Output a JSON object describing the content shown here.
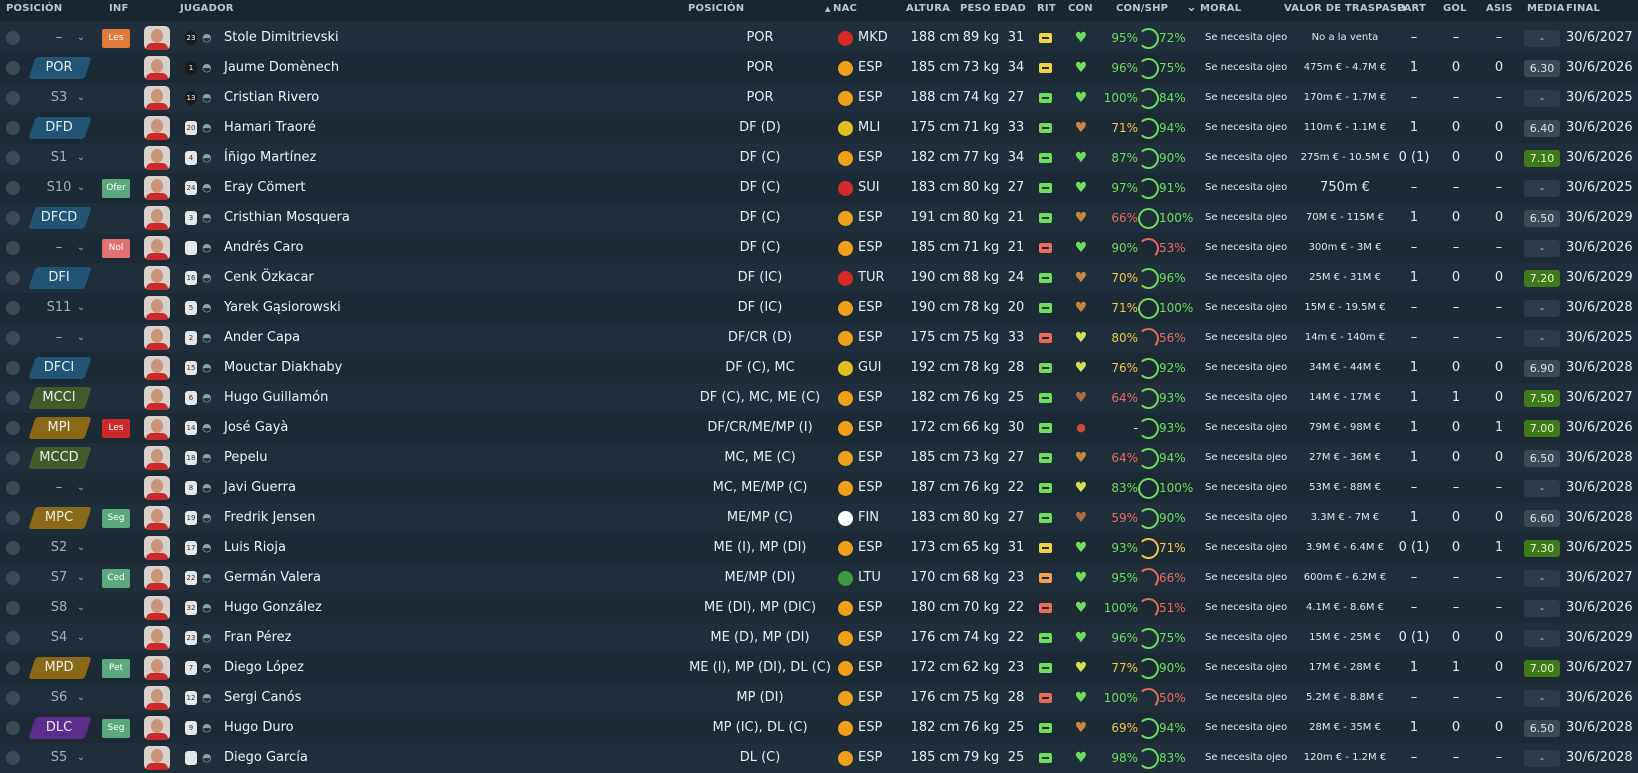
{
  "header": {
    "posicion": "POSICIÓN",
    "inf": "INF",
    "jugador": "JUGADOR",
    "posicion2": "POSICIÓN",
    "nac": "NAC",
    "altura": "ALTURA",
    "peso": "PESO",
    "edad": "EDAD",
    "rit": "RIT",
    "con": "CON",
    "conshp": "CON/SHP",
    "moral": "MORAL",
    "valor": "VALOR DE TRASPASO",
    "part": "PART",
    "gol": "GOL",
    "asis": "ASIS",
    "media": "MEDIA",
    "final": "FINAL",
    "sort_icon": "▲",
    "filter_icon": "⌄"
  },
  "colors": {
    "pos_colors": {
      "POR": "#225476",
      "DFD": "#225476",
      "DFCD": "#225476",
      "DFI": "#225476",
      "DFCI": "#225476",
      "MCCI": "#3e5d2a",
      "MCCD": "#3e5d2a",
      "MPI": "#8a6a16",
      "MPC": "#8a6a16",
      "MPD": "#8a6a16",
      "DLC": "#5c2c8c"
    },
    "inf_colors": {
      "Les": "#cc2a2a",
      "Les2": "#e07b3a",
      "Ofer": "#5aa87b",
      "Nol": "#e07272",
      "Seg": "#5aa87b",
      "Ced": "#5aa87b",
      "Pet": "#5aa87b"
    },
    "rit_colors": {
      "yellow": "#f3d444",
      "green": "#6fdc5c",
      "salmon": "#ec6a5c",
      "orange": "#f0a050"
    },
    "con_colors": {
      "green": "#6fdc5c",
      "brown": "#c9843e",
      "yellow": "#d7de55",
      "redbrown": "#a86b43",
      "red": "#d04a3a"
    },
    "shp_colors": {
      "green": "#6fdc5c",
      "salmon": "#ec6a5c",
      "yellow": "#f0c84a"
    }
  },
  "rows": [
    {
      "pos": "–",
      "posc": "",
      "inf": "Les",
      "infc": "Les2",
      "name": "Stole Dimitrievski",
      "num": "23",
      "numDark": true,
      "rpos": "POR",
      "flag": "#d52a2a",
      "nat": "MKD",
      "alt": "188 cm",
      "peso": "89 kg",
      "edad": "31",
      "rit": "yellow",
      "con": "green",
      "conp": "95%",
      "ring": "green",
      "shp": "72%",
      "shpc": "green",
      "moral": "Se necesita ojeo",
      "val": "No a la venta",
      "valBig": false,
      "part": "–",
      "gol": "–",
      "asis": "–",
      "media": "-",
      "mediaType": "dash",
      "final": "30/6/2027"
    },
    {
      "pos": "POR",
      "posc": "POR",
      "inf": "",
      "infc": "",
      "name": "Jaume Domènech",
      "num": "1",
      "numDark": true,
      "rpos": "POR",
      "flag": "#f0a018",
      "nat": "ESP",
      "alt": "185 cm",
      "peso": "73 kg",
      "edad": "34",
      "rit": "yellow",
      "con": "green",
      "conp": "96%",
      "ring": "green",
      "shp": "75%",
      "shpc": "green",
      "moral": "Se necesita ojeo",
      "val": "475m € - 4.7M €",
      "valBig": false,
      "part": "1",
      "gol": "0",
      "asis": "0",
      "media": "6.30",
      "mediaType": "mid",
      "final": "30/6/2026"
    },
    {
      "pos": "S3",
      "posc": "",
      "inf": "",
      "infc": "",
      "name": "Cristian Rivero",
      "num": "13",
      "numDark": true,
      "rpos": "POR",
      "flag": "#f0a018",
      "nat": "ESP",
      "alt": "188 cm",
      "peso": "74 kg",
      "edad": "27",
      "rit": "green",
      "con": "green",
      "conp": "100%",
      "ring": "green",
      "shp": "84%",
      "shpc": "green",
      "moral": "Se necesita ojeo",
      "val": "170m € - 1.7M €",
      "valBig": false,
      "part": "–",
      "gol": "–",
      "asis": "–",
      "media": "-",
      "mediaType": "dash",
      "final": "30/6/2025"
    },
    {
      "pos": "DFD",
      "posc": "DFD",
      "inf": "",
      "infc": "",
      "name": "Hamari Traoré",
      "num": "20",
      "numDark": false,
      "rpos": "DF (D)",
      "flag": "#e0c020",
      "nat": "MLI",
      "alt": "175 cm",
      "peso": "71 kg",
      "edad": "33",
      "rit": "green",
      "con": "brown",
      "conp": "71%",
      "conpc": "yellow",
      "ring": "green",
      "shp": "94%",
      "shpc": "green",
      "moral": "Se necesita ojeo",
      "val": "110m € - 1.1M €",
      "valBig": false,
      "part": "1",
      "gol": "0",
      "asis": "0",
      "media": "6.40",
      "mediaType": "mid",
      "final": "30/6/2026"
    },
    {
      "pos": "S1",
      "posc": "",
      "inf": "",
      "infc": "",
      "name": "Íñigo Martínez",
      "num": "4",
      "numDark": false,
      "rpos": "DF (C)",
      "flag": "#f0a018",
      "nat": "ESP",
      "alt": "182 cm",
      "peso": "77 kg",
      "edad": "34",
      "rit": "green",
      "con": "green",
      "conp": "87%",
      "ring": "green",
      "shp": "90%",
      "shpc": "green",
      "moral": "Se necesita ojeo",
      "val": "275m € - 10.5M €",
      "valBig": false,
      "part": "0 (1)",
      "gol": "0",
      "asis": "0",
      "media": "7.10",
      "mediaType": "good",
      "final": "30/6/2026"
    },
    {
      "pos": "S10",
      "posc": "",
      "inf": "Ofer",
      "infc": "Ofer",
      "name": "Eray Cömert",
      "num": "24",
      "numDark": false,
      "rpos": "DF (C)",
      "flag": "#d52a2a",
      "nat": "SUI",
      "alt": "183 cm",
      "peso": "80 kg",
      "edad": "27",
      "rit": "green",
      "con": "green",
      "conp": "97%",
      "ring": "green",
      "shp": "91%",
      "shpc": "green",
      "moral": "Se necesita ojeo",
      "val": "750m €",
      "valBig": true,
      "part": "–",
      "gol": "–",
      "asis": "–",
      "media": "-",
      "mediaType": "dash",
      "final": "30/6/2025"
    },
    {
      "pos": "DFCD",
      "posc": "DFCD",
      "inf": "",
      "infc": "",
      "name": "Cristhian Mosquera",
      "num": "3",
      "numDark": false,
      "rpos": "DF (C)",
      "flag": "#f0a018",
      "nat": "ESP",
      "alt": "191 cm",
      "peso": "80 kg",
      "edad": "21",
      "rit": "green",
      "con": "brown",
      "conp": "66%",
      "conpc": "salmon",
      "ring": "green",
      "shp": "100%",
      "shpc": "green",
      "moral": "Se necesita ojeo",
      "val": "70M € - 115M €",
      "valBig": false,
      "part": "1",
      "gol": "0",
      "asis": "0",
      "media": "6.50",
      "mediaType": "mid",
      "final": "30/6/2029"
    },
    {
      "pos": "–",
      "posc": "",
      "inf": "Nol",
      "infc": "Nol",
      "name": "Andrés Caro",
      "num": "",
      "numDark": false,
      "rpos": "DF (C)",
      "flag": "#f0a018",
      "nat": "ESP",
      "alt": "185 cm",
      "peso": "71 kg",
      "edad": "21",
      "rit": "salmon",
      "con": "green",
      "conp": "90%",
      "ring": "salmon",
      "shp": "53%",
      "shpc": "salmon",
      "moral": "Se necesita ojeo",
      "val": "300m € - 3M €",
      "valBig": false,
      "part": "–",
      "gol": "–",
      "asis": "–",
      "media": "-",
      "mediaType": "dash",
      "final": "30/6/2026"
    },
    {
      "pos": "DFI",
      "posc": "DFI",
      "inf": "",
      "infc": "",
      "name": "Cenk Özkacar",
      "num": "16",
      "numDark": false,
      "rpos": "DF (IC)",
      "flag": "#d52a2a",
      "nat": "TUR",
      "alt": "190 cm",
      "peso": "88 kg",
      "edad": "24",
      "rit": "green",
      "con": "brown",
      "conp": "70%",
      "conpc": "yellow",
      "ring": "green",
      "shp": "96%",
      "shpc": "green",
      "moral": "Se necesita ojeo",
      "val": "25M € - 31M €",
      "valBig": false,
      "part": "1",
      "gol": "0",
      "asis": "0",
      "media": "7.20",
      "mediaType": "good",
      "final": "30/6/2029"
    },
    {
      "pos": "S11",
      "posc": "",
      "inf": "",
      "infc": "",
      "name": "Yarek Gąsiorowski",
      "num": "5",
      "numDark": false,
      "rpos": "DF (IC)",
      "flag": "#f0a018",
      "nat": "ESP",
      "alt": "190 cm",
      "peso": "78 kg",
      "edad": "20",
      "rit": "green",
      "con": "brown",
      "conp": "71%",
      "conpc": "yellow",
      "ring": "green",
      "shp": "100%",
      "shpc": "green",
      "moral": "Se necesita ojeo",
      "val": "15M € - 19.5M €",
      "valBig": false,
      "part": "–",
      "gol": "–",
      "asis": "–",
      "media": "-",
      "mediaType": "dash",
      "final": "30/6/2028"
    },
    {
      "pos": "–",
      "posc": "",
      "inf": "",
      "infc": "",
      "name": "Ander Capa",
      "num": "2",
      "numDark": false,
      "rpos": "DF/CR (D)",
      "flag": "#f0a018",
      "nat": "ESP",
      "alt": "175 cm",
      "peso": "75 kg",
      "edad": "33",
      "rit": "salmon",
      "con": "yellow",
      "conp": "80%",
      "conpc": "yellow",
      "ring": "salmon",
      "shp": "56%",
      "shpc": "salmon",
      "moral": "Se necesita ojeo",
      "val": "14m € - 140m €",
      "valBig": false,
      "part": "–",
      "gol": "–",
      "asis": "–",
      "media": "-",
      "mediaType": "dash",
      "final": "30/6/2025"
    },
    {
      "pos": "DFCI",
      "posc": "DFCI",
      "inf": "",
      "infc": "",
      "name": "Mouctar Diakhaby",
      "num": "15",
      "numDark": false,
      "rpos": "DF (C), MC",
      "flag": "#e0c020",
      "nat": "GUI",
      "alt": "192 cm",
      "peso": "78 kg",
      "edad": "28",
      "rit": "green",
      "con": "yellow",
      "conp": "76%",
      "conpc": "yellow",
      "ring": "green",
      "shp": "92%",
      "shpc": "green",
      "moral": "Se necesita ojeo",
      "val": "34M € - 44M €",
      "valBig": false,
      "part": "1",
      "gol": "0",
      "asis": "0",
      "media": "6.90",
      "mediaType": "mid",
      "final": "30/6/2028"
    },
    {
      "pos": "MCCI",
      "posc": "MCCI",
      "inf": "",
      "infc": "",
      "name": "Hugo Guillamón",
      "num": "6",
      "numDark": false,
      "rpos": "DF (C), MC, ME (C)",
      "flag": "#f0a018",
      "nat": "ESP",
      "alt": "182 cm",
      "peso": "76 kg",
      "edad": "25",
      "rit": "green",
      "con": "redbrown",
      "conp": "64%",
      "conpc": "salmon",
      "ring": "green",
      "shp": "93%",
      "shpc": "green",
      "moral": "Se necesita ojeo",
      "val": "14M € - 17M €",
      "valBig": false,
      "part": "1",
      "gol": "1",
      "asis": "0",
      "media": "7.50",
      "mediaType": "good",
      "final": "30/6/2027"
    },
    {
      "pos": "MPI",
      "posc": "MPI",
      "inf": "Les",
      "infc": "Les",
      "name": "José Gayà",
      "num": "14",
      "numDark": false,
      "rpos": "DF/CR/ME/MP (I)",
      "flag": "#f0a018",
      "nat": "ESP",
      "alt": "172 cm",
      "peso": "66 kg",
      "edad": "30",
      "rit": "green",
      "con": "red",
      "conp": "-",
      "conpc": "plain",
      "ring": "green",
      "shp": "93%",
      "shpc": "green",
      "moral": "Se necesita ojeo",
      "val": "79M € - 98M €",
      "valBig": false,
      "part": "1",
      "gol": "0",
      "asis": "1",
      "media": "7.00",
      "mediaType": "good",
      "final": "30/6/2026"
    },
    {
      "pos": "MCCD",
      "posc": "MCCD",
      "inf": "",
      "infc": "",
      "name": "Pepelu",
      "num": "18",
      "numDark": false,
      "rpos": "MC, ME (C)",
      "flag": "#f0a018",
      "nat": "ESP",
      "alt": "185 cm",
      "peso": "73 kg",
      "edad": "27",
      "rit": "green",
      "con": "brown",
      "conp": "64%",
      "conpc": "salmon",
      "ring": "green",
      "shp": "94%",
      "shpc": "green",
      "moral": "Se necesita ojeo",
      "val": "27M € - 36M €",
      "valBig": false,
      "part": "1",
      "gol": "0",
      "asis": "0",
      "media": "6.50",
      "mediaType": "mid",
      "final": "30/6/2028"
    },
    {
      "pos": "–",
      "posc": "",
      "inf": "",
      "infc": "",
      "name": "Javi Guerra",
      "num": "8",
      "numDark": false,
      "rpos": "MC, ME/MP (C)",
      "flag": "#f0a018",
      "nat": "ESP",
      "alt": "187 cm",
      "peso": "76 kg",
      "edad": "22",
      "rit": "green",
      "con": "yellow",
      "conp": "83%",
      "conpc": "green",
      "ring": "green",
      "shp": "100%",
      "shpc": "green",
      "moral": "Se necesita ojeo",
      "val": "53M € - 88M €",
      "valBig": false,
      "part": "–",
      "gol": "–",
      "asis": "–",
      "media": "-",
      "mediaType": "dash",
      "final": "30/6/2028"
    },
    {
      "pos": "MPC",
      "posc": "MPC",
      "inf": "Seg",
      "infc": "Seg",
      "name": "Fredrik Jensen",
      "num": "19",
      "numDark": false,
      "rpos": "ME/MP (C)",
      "flag": "#ffffff",
      "nat": "FIN",
      "alt": "183 cm",
      "peso": "80 kg",
      "edad": "27",
      "rit": "green",
      "con": "redbrown",
      "conp": "59%",
      "conpc": "salmon",
      "ring": "green",
      "shp": "90%",
      "shpc": "green",
      "moral": "Se necesita ojeo",
      "val": "3.3M € - 7M €",
      "valBig": false,
      "part": "1",
      "gol": "0",
      "asis": "0",
      "media": "6.60",
      "mediaType": "mid",
      "final": "30/6/2028"
    },
    {
      "pos": "S2",
      "posc": "",
      "inf": "",
      "infc": "",
      "name": "Luis Rioja",
      "num": "17",
      "numDark": false,
      "rpos": "ME (I), MP (DI)",
      "flag": "#f0a018",
      "nat": "ESP",
      "alt": "173 cm",
      "peso": "65 kg",
      "edad": "31",
      "rit": "yellow",
      "con": "green",
      "conp": "93%",
      "conpc": "green",
      "ring": "yellow",
      "shp": "71%",
      "shpc": "yellow",
      "moral": "Se necesita ojeo",
      "val": "3.9M € - 6.4M €",
      "valBig": false,
      "part": "0 (1)",
      "gol": "0",
      "asis": "1",
      "media": "7.30",
      "mediaType": "good",
      "final": "30/6/2025"
    },
    {
      "pos": "S7",
      "posc": "",
      "inf": "Ced",
      "infc": "Ced",
      "name": "Germán Valera",
      "num": "22",
      "numDark": false,
      "rpos": "ME/MP (DI)",
      "flag": "#3e9a3e",
      "nat": "LTU",
      "alt": "170 cm",
      "peso": "68 kg",
      "edad": "23",
      "rit": "orange",
      "con": "green",
      "conp": "95%",
      "conpc": "green",
      "ring": "salmon",
      "shp": "66%",
      "shpc": "salmon",
      "moral": "Se necesita ojeo",
      "val": "600m € - 6.2M €",
      "valBig": false,
      "part": "–",
      "gol": "–",
      "asis": "–",
      "media": "-",
      "mediaType": "dash",
      "final": "30/6/2027"
    },
    {
      "pos": "S8",
      "posc": "",
      "inf": "",
      "infc": "",
      "name": "Hugo González",
      "num": "32",
      "numDark": false,
      "rpos": "ME (DI), MP (DIC)",
      "flag": "#f0a018",
      "nat": "ESP",
      "alt": "180 cm",
      "peso": "70 kg",
      "edad": "22",
      "rit": "salmon",
      "con": "green",
      "conp": "100%",
      "conpc": "green",
      "ring": "salmon",
      "shp": "51%",
      "shpc": "salmon",
      "moral": "Se necesita ojeo",
      "val": "4.1M € - 8.6M €",
      "valBig": false,
      "part": "–",
      "gol": "–",
      "asis": "–",
      "media": "-",
      "mediaType": "dash",
      "final": "30/6/2026"
    },
    {
      "pos": "S4",
      "posc": "",
      "inf": "",
      "infc": "",
      "name": "Fran Pérez",
      "num": "23",
      "numDark": false,
      "rpos": "ME (D), MP (DI)",
      "flag": "#f0a018",
      "nat": "ESP",
      "alt": "176 cm",
      "peso": "74 kg",
      "edad": "22",
      "rit": "green",
      "con": "green",
      "conp": "96%",
      "conpc": "green",
      "ring": "green",
      "shp": "75%",
      "shpc": "green",
      "moral": "Se necesita ojeo",
      "val": "15M € - 25M €",
      "valBig": false,
      "part": "0 (1)",
      "gol": "0",
      "asis": "0",
      "media": "-",
      "mediaType": "dash",
      "final": "30/6/2029"
    },
    {
      "pos": "MPD",
      "posc": "MPD",
      "inf": "Pet",
      "infc": "Pet",
      "name": "Diego López",
      "num": "7",
      "numDark": false,
      "rpos": "ME (I), MP (DI), DL (C)",
      "flag": "#f0a018",
      "nat": "ESP",
      "alt": "172 cm",
      "peso": "62 kg",
      "edad": "23",
      "rit": "green",
      "con": "yellow",
      "conp": "77%",
      "conpc": "yellow",
      "ring": "green",
      "shp": "90%",
      "shpc": "green",
      "moral": "Se necesita ojeo",
      "val": "17M € - 28M €",
      "valBig": false,
      "part": "1",
      "gol": "1",
      "asis": "0",
      "media": "7.00",
      "mediaType": "good",
      "final": "30/6/2027"
    },
    {
      "pos": "S6",
      "posc": "",
      "inf": "",
      "infc": "",
      "name": "Sergi Canós",
      "num": "12",
      "numDark": false,
      "rpos": "MP (DI)",
      "flag": "#f0a018",
      "nat": "ESP",
      "alt": "176 cm",
      "peso": "75 kg",
      "edad": "28",
      "rit": "salmon",
      "con": "green",
      "conp": "100%",
      "conpc": "green",
      "ring": "salmon",
      "shp": "50%",
      "shpc": "salmon",
      "moral": "Se necesita ojeo",
      "val": "5.2M € - 8.8M €",
      "valBig": false,
      "part": "–",
      "gol": "–",
      "asis": "–",
      "media": "-",
      "mediaType": "dash",
      "final": "30/6/2026"
    },
    {
      "pos": "DLC",
      "posc": "DLC",
      "inf": "Seg",
      "infc": "Seg",
      "name": "Hugo Duro",
      "num": "9",
      "numDark": false,
      "rpos": "MP (IC), DL (C)",
      "flag": "#f0a018",
      "nat": "ESP",
      "alt": "182 cm",
      "peso": "76 kg",
      "edad": "25",
      "rit": "green",
      "con": "brown",
      "conp": "69%",
      "conpc": "yellow",
      "ring": "green",
      "shp": "94%",
      "shpc": "green",
      "moral": "Se necesita ojeo",
      "val": "28M € - 35M €",
      "valBig": false,
      "part": "1",
      "gol": "0",
      "asis": "0",
      "media": "6.50",
      "mediaType": "mid",
      "final": "30/6/2028"
    },
    {
      "pos": "S5",
      "posc": "",
      "inf": "",
      "infc": "",
      "name": "Diego García",
      "num": "",
      "numDark": false,
      "rpos": "DL (C)",
      "flag": "#f0a018",
      "nat": "ESP",
      "alt": "185 cm",
      "peso": "79 kg",
      "edad": "25",
      "rit": "green",
      "con": "green",
      "conp": "98%",
      "conpc": "green",
      "ring": "green",
      "shp": "83%",
      "shpc": "green",
      "moral": "Se necesita ojeo",
      "val": "120m € - 1.2M €",
      "valBig": false,
      "part": "–",
      "gol": "–",
      "asis": "–",
      "media": "-",
      "mediaType": "dash",
      "final": "30/6/2028"
    }
  ]
}
